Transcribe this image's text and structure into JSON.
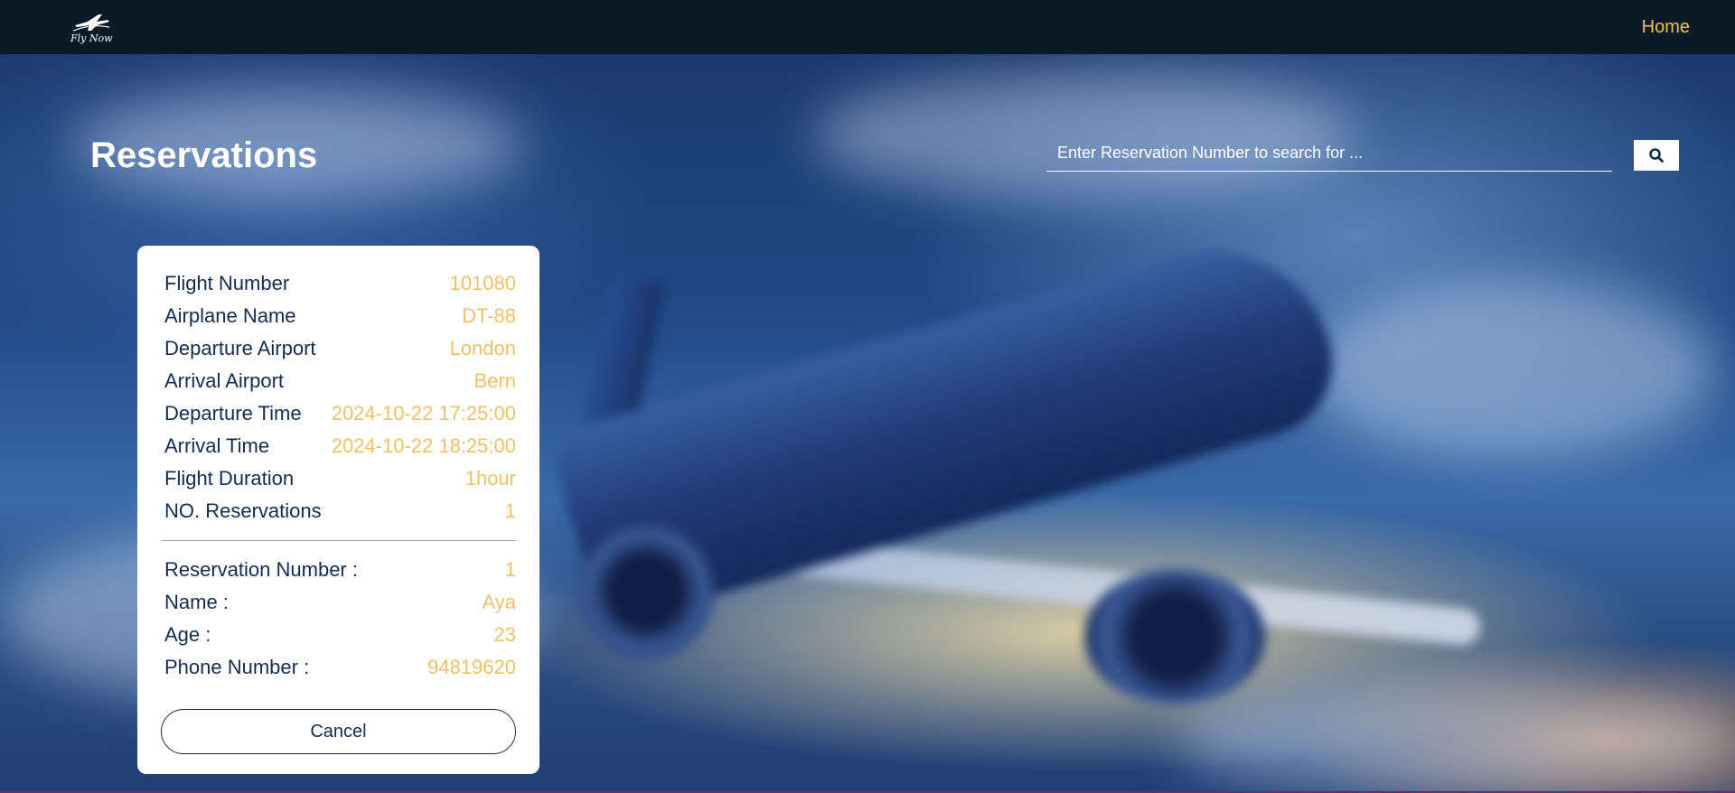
{
  "header": {
    "logo_text": "Fly Now",
    "home_label": "Home"
  },
  "page": {
    "title": "Reservations"
  },
  "search": {
    "placeholder": "Enter Reservation Number to search for ...",
    "icon": "search-icon"
  },
  "flight": [
    {
      "label": "Flight Number",
      "value": "101080"
    },
    {
      "label": "Airplane Name",
      "value": "DT-88"
    },
    {
      "label": "Departure Airport",
      "value": "London"
    },
    {
      "label": "Arrival Airport",
      "value": "Bern"
    },
    {
      "label": "Departure Time",
      "value": "2024-10-22 17:25:00"
    },
    {
      "label": "Arrival Time",
      "value": "2024-10-22 18:25:00"
    },
    {
      "label": "Flight Duration",
      "value": "1hour"
    },
    {
      "label": "NO. Reservations",
      "value": "1"
    }
  ],
  "reservation": [
    {
      "label": "Reservation Number :",
      "value": "1"
    },
    {
      "label": "Name :",
      "value": "Aya"
    },
    {
      "label": "Age :",
      "value": "23"
    },
    {
      "label": "Phone Number :",
      "value": "94819620"
    }
  ],
  "actions": {
    "cancel_label": "Cancel"
  },
  "colors": {
    "navbar": "#0b1a27",
    "accent": "#f0c052",
    "label_text": "#142b52",
    "value_text": "#f0c068"
  }
}
